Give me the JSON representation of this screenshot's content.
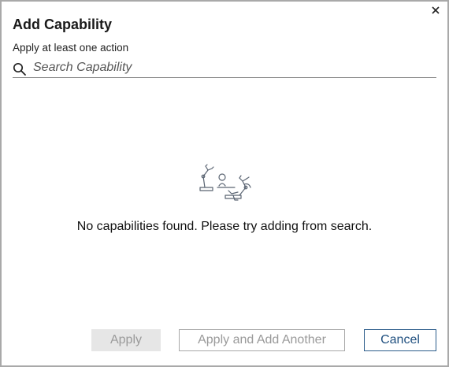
{
  "dialog": {
    "title": "Add Capability",
    "subtitle": "Apply at least one action",
    "close_icon": "close-icon"
  },
  "search": {
    "placeholder": "Search Capability",
    "value": "",
    "icon": "search-icon"
  },
  "empty_state": {
    "illustration": "robot-arms-icon",
    "message": "No capabilities found. Please try adding from search."
  },
  "footer": {
    "apply_label": "Apply",
    "apply_and_add_another_label": "Apply and Add Another",
    "cancel_label": "Cancel"
  },
  "colors": {
    "border": "#a9a9a9",
    "cancel_accent": "#2b5c8a",
    "disabled_bg": "#e6e6e6",
    "disabled_text": "#9a9a9a"
  }
}
